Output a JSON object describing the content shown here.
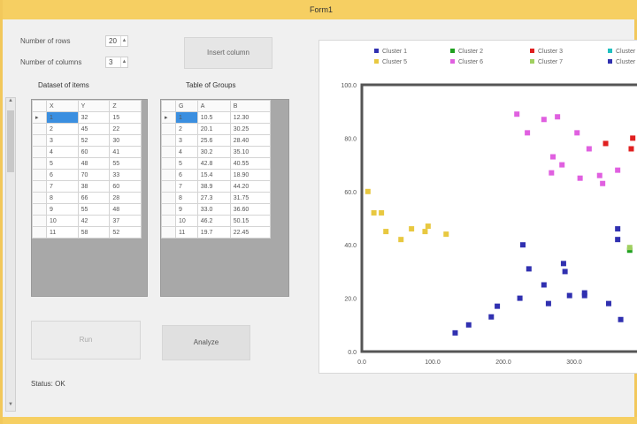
{
  "window": {
    "title": "Form1"
  },
  "controls": {
    "label1": "Number of rows",
    "value1": "20",
    "label2": "Number of columns",
    "value2": "3",
    "top_button": "Insert column",
    "small_button": "Run",
    "main_button": "Analyze",
    "status": "Status: OK"
  },
  "grid_left": {
    "title": "Dataset of items",
    "columns": [
      "X",
      "Y",
      "Z"
    ],
    "rows": [
      [
        "1",
        "32",
        "15"
      ],
      [
        "2",
        "45",
        "22"
      ],
      [
        "3",
        "52",
        "30"
      ],
      [
        "4",
        "60",
        "41"
      ],
      [
        "5",
        "48",
        "55"
      ],
      [
        "6",
        "70",
        "33"
      ],
      [
        "7",
        "38",
        "60"
      ],
      [
        "8",
        "66",
        "28"
      ],
      [
        "9",
        "55",
        "48"
      ],
      [
        "10",
        "42",
        "37"
      ],
      [
        "11",
        "58",
        "52"
      ]
    ]
  },
  "grid_right": {
    "title": "Table of Groups",
    "columns": [
      "G",
      "A",
      "B"
    ],
    "rows": [
      [
        "1",
        "10.5",
        "12.30"
      ],
      [
        "2",
        "20.1",
        "30.25"
      ],
      [
        "3",
        "25.6",
        "28.40"
      ],
      [
        "4",
        "30.2",
        "35.10"
      ],
      [
        "5",
        "42.8",
        "40.55"
      ],
      [
        "6",
        "15.4",
        "18.90"
      ],
      [
        "7",
        "38.9",
        "44.20"
      ],
      [
        "8",
        "27.3",
        "31.75"
      ],
      [
        "9",
        "33.0",
        "36.60"
      ],
      [
        "10",
        "46.2",
        "50.15"
      ],
      [
        "11",
        "19.7",
        "22.45"
      ]
    ]
  },
  "chart_data": {
    "type": "scatter",
    "title": "",
    "xlabel": "",
    "ylabel": "",
    "xlim": [
      0,
      2000
    ],
    "ylim": [
      0,
      1000
    ],
    "xticks": [
      "0.0",
      "100.0",
      "200.0",
      "300.0",
      "400.0"
    ],
    "yticks": [
      "100.0",
      "80.0",
      "60.0",
      "40.0",
      "20.0",
      "0.0"
    ],
    "legend_position": "top",
    "series": [
      {
        "name": "Cluster 1",
        "color": "#3030b0",
        "points": [
          [
            620,
            70
          ],
          [
            710,
            100
          ],
          [
            860,
            130
          ],
          [
            900,
            170
          ],
          [
            1050,
            200
          ],
          [
            1240,
            180
          ],
          [
            1210,
            250
          ],
          [
            1380,
            210
          ],
          [
            1480,
            220
          ],
          [
            1350,
            300
          ],
          [
            1110,
            310
          ],
          [
            1340,
            330
          ],
          [
            1480,
            210
          ],
          [
            1070,
            400
          ]
        ]
      },
      {
        "name": "Cluster 2",
        "color": "#20a020",
        "points": [
          [
            1780,
            380
          ],
          [
            1880,
            410
          ],
          [
            1950,
            420
          ],
          [
            1900,
            470
          ]
        ]
      },
      {
        "name": "Cluster 3",
        "color": "#e02020",
        "points": [
          [
            1620,
            780
          ],
          [
            1790,
            760
          ],
          [
            1800,
            800
          ]
        ]
      },
      {
        "name": "Cluster 4",
        "color": "#20c0c0",
        "points": [
          [
            1910,
            700
          ]
        ]
      },
      {
        "name": "Cluster 5",
        "color": "#e8c840",
        "points": [
          [
            40,
            600
          ],
          [
            80,
            520
          ],
          [
            130,
            520
          ],
          [
            160,
            450
          ],
          [
            260,
            420
          ],
          [
            330,
            460
          ],
          [
            420,
            450
          ],
          [
            440,
            470
          ],
          [
            560,
            440
          ]
        ]
      },
      {
        "name": "Cluster 6",
        "color": "#e060e0",
        "points": [
          [
            1030,
            890
          ],
          [
            1210,
            870
          ],
          [
            1300,
            880
          ],
          [
            1100,
            820
          ],
          [
            1270,
            730
          ],
          [
            1330,
            700
          ],
          [
            1430,
            820
          ],
          [
            1510,
            760
          ],
          [
            1700,
            680
          ],
          [
            1580,
            660
          ],
          [
            1450,
            650
          ],
          [
            1260,
            670
          ],
          [
            1600,
            630
          ]
        ]
      },
      {
        "name": "Cluster 7",
        "color": "#a0d060",
        "points": [
          [
            1780,
            390
          ],
          [
            1850,
            430
          ],
          [
            1900,
            360
          ],
          [
            1960,
            410
          ],
          [
            1850,
            330
          ]
        ]
      },
      {
        "name": "Cluster 8",
        "color": "#3030b0",
        "points": [
          [
            1640,
            180
          ],
          [
            1720,
            120
          ],
          [
            1700,
            460
          ],
          [
            1840,
            480
          ],
          [
            1900,
            300
          ],
          [
            1950,
            240
          ],
          [
            1700,
            420
          ],
          [
            1990,
            310
          ]
        ]
      }
    ]
  }
}
